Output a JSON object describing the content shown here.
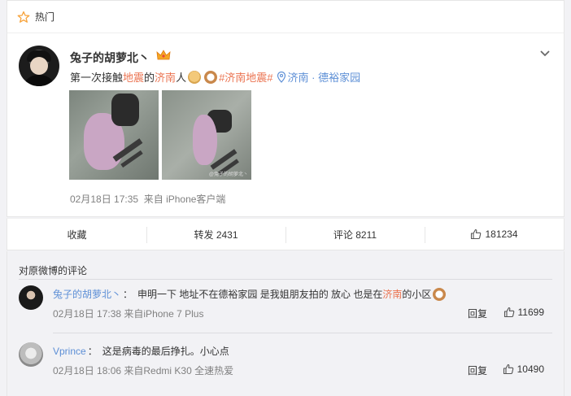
{
  "hot_bar": {
    "label": "热门",
    "icon": "star-outline-icon"
  },
  "post": {
    "username": "兔子的胡萝北丶",
    "badge_icon": "crown-icon",
    "text_prefix": "第一次接触",
    "link_quake": "地震",
    "text_mid": "的",
    "link_jinan": "济南",
    "text_suffix": "人",
    "topic": "#济南地震#",
    "location": "济南 · 德裕家园",
    "photo_watermark": "@兔子的胡萝北丶",
    "date": "02月18日 17:35",
    "source": "来自 iPhone客户端"
  },
  "actions": {
    "favorite": "收藏",
    "repost": "转发 2431",
    "comment": "评论 8211",
    "likes": "181234"
  },
  "comments": {
    "title": "对原微博的评论",
    "items": [
      {
        "user": "兔子的胡萝北丶",
        "separator": "：",
        "text_a": "申明一下 地址不在德裕家园 是我姐朋友拍的 放心 也是在",
        "text_link": "济南",
        "text_b": "的小区",
        "meta": "02月18日 17:38 来自iPhone 7 Plus",
        "reply": "回复",
        "likes": "11699"
      },
      {
        "user": "Vprince",
        "separator": "：",
        "text_a": "这是病毒的最后挣扎。小心点",
        "meta": "02月18日 18:06 来自Redmi K30 全速热爱",
        "reply": "回复",
        "likes": "10490"
      }
    ]
  },
  "colors": {
    "link": "#eb7350",
    "user": "#5d8fd6",
    "meta": "#808080"
  }
}
